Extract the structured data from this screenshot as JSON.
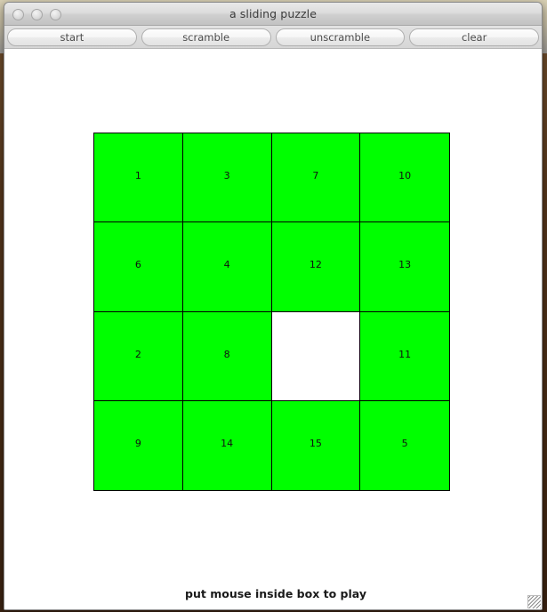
{
  "window": {
    "title": "a sliding puzzle",
    "traffic_lights": [
      {
        "name": "close-button",
        "label": "close"
      },
      {
        "name": "minimize-button",
        "label": "minimize"
      },
      {
        "name": "zoom-button",
        "label": "zoom"
      }
    ],
    "resize_grip_label": "resize"
  },
  "toolbar": {
    "buttons": [
      {
        "id": "start",
        "label": "start"
      },
      {
        "id": "scramble",
        "label": "scramble"
      },
      {
        "id": "unscramble",
        "label": "unscramble"
      },
      {
        "id": "clear",
        "label": "clear"
      }
    ]
  },
  "puzzle": {
    "rows": 4,
    "columns": 4,
    "tile_color": "#00ff00",
    "blank_color": "#ffffff",
    "border_color": "#000000",
    "number_color": "#111111",
    "tiles": [
      {
        "row": 0,
        "col": 0,
        "label": "1",
        "blank": false
      },
      {
        "row": 0,
        "col": 1,
        "label": "3",
        "blank": false
      },
      {
        "row": 0,
        "col": 2,
        "label": "7",
        "blank": false
      },
      {
        "row": 0,
        "col": 3,
        "label": "10",
        "blank": false
      },
      {
        "row": 1,
        "col": 0,
        "label": "6",
        "blank": false
      },
      {
        "row": 1,
        "col": 1,
        "label": "4",
        "blank": false
      },
      {
        "row": 1,
        "col": 2,
        "label": "12",
        "blank": false
      },
      {
        "row": 1,
        "col": 3,
        "label": "13",
        "blank": false
      },
      {
        "row": 2,
        "col": 0,
        "label": "2",
        "blank": false
      },
      {
        "row": 2,
        "col": 1,
        "label": "8",
        "blank": false
      },
      {
        "row": 2,
        "col": 2,
        "label": "",
        "blank": true
      },
      {
        "row": 2,
        "col": 3,
        "label": "11",
        "blank": false
      },
      {
        "row": 3,
        "col": 0,
        "label": "9",
        "blank": false
      },
      {
        "row": 3,
        "col": 1,
        "label": "14",
        "blank": false
      },
      {
        "row": 3,
        "col": 2,
        "label": "15",
        "blank": false
      },
      {
        "row": 3,
        "col": 3,
        "label": "5",
        "blank": false
      }
    ]
  },
  "status": {
    "message": "put mouse inside box to play"
  }
}
